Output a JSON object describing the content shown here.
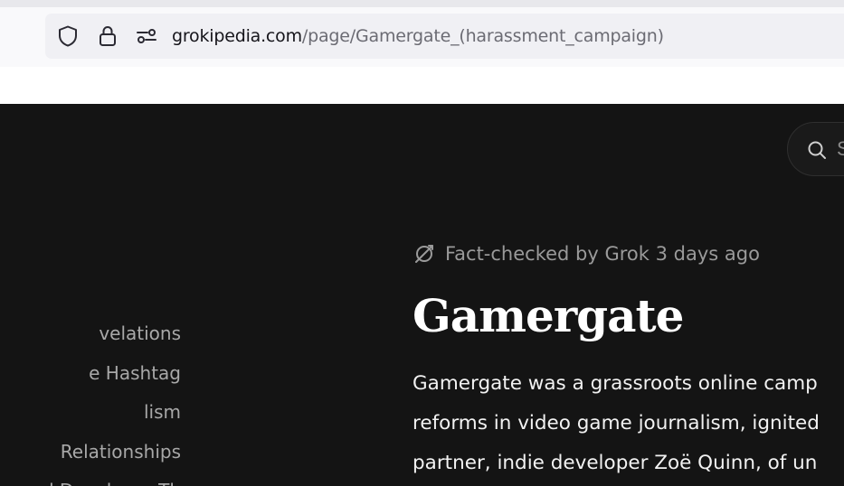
{
  "browser": {
    "url_host": "grokipedia.com",
    "url_path": "/page/Gamergate_(harassment_campaign)",
    "icons": [
      "shield-icon",
      "lock-icon",
      "permissions-icon"
    ]
  },
  "page": {
    "search_label": "S",
    "toc": [
      "velations",
      "e Hashtag",
      "lism",
      " Relationships",
      "d Developer Th"
    ],
    "fact_check": "Fact-checked by Grok 3 days ago",
    "title": "Gamergate",
    "body_lines": [
      "Gamergate was a grassroots online camp",
      "reforms in video game journalism, ignited",
      "partner, indie developer Zoë Quinn, of un"
    ],
    "colors": {
      "page_bg": "#141414",
      "title": "#ffffff",
      "muted": "#9a9a9a"
    }
  }
}
